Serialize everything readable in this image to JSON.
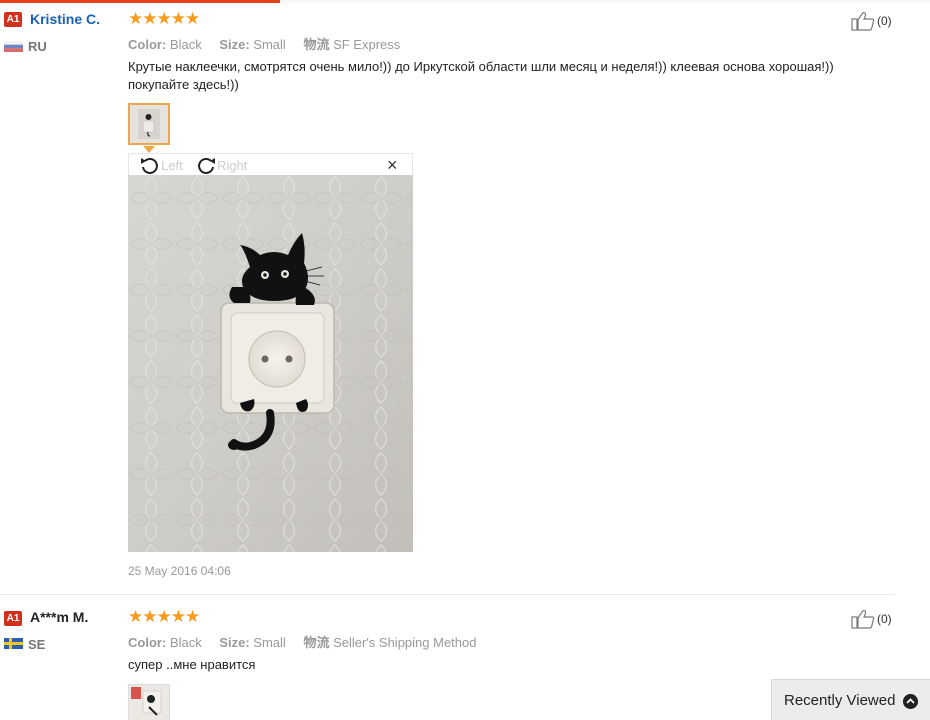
{
  "reviews": [
    {
      "rank": "A1",
      "user": "Kristine C.",
      "country": "RU",
      "stars": "★★★★★",
      "color_label": "Color:",
      "color_value": "Black",
      "size_label": "Size:",
      "size_value": "Small",
      "ship_label": "物流",
      "ship_value": "SF Express",
      "text": "Крутые наклеечки, смотрятся очень мило!)) до Иркутской области шли месяц и неделя!)) клеевая основа хорошая!)) покупайте здесь!))",
      "helpful": "(0)",
      "date": "25 May 2016 04:06"
    },
    {
      "rank": "A1",
      "user": "A***m M.",
      "country": "SE",
      "stars": "★★★★★",
      "color_label": "Color:",
      "color_value": "Black",
      "size_label": "Size:",
      "size_value": "Small",
      "ship_label": "物流",
      "ship_value": "Seller's Shipping Method",
      "text": "супер ..мне нравится",
      "helpful": "(0)"
    }
  ],
  "viewer": {
    "rotate_left": "Left",
    "rotate_right": "Right",
    "close": "×"
  },
  "recently_viewed": "Recently Viewed",
  "colors": {
    "accent": "#e2401c",
    "star": "#f89a1c",
    "link": "#1a62b5",
    "badge": "#d1301f"
  }
}
